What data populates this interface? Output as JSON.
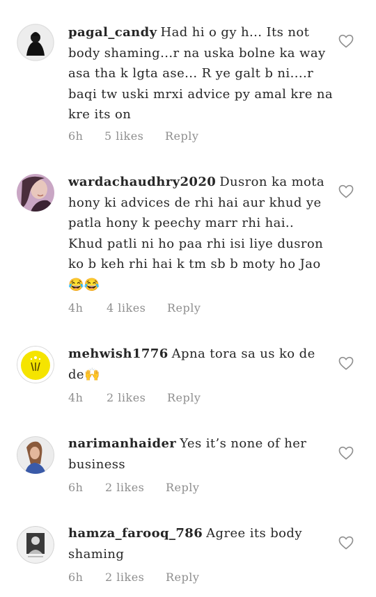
{
  "comments": [
    {
      "username": "pagal_candy",
      "text": "Had hi o gy h... Its not body shaming...r na uska bolne ka way asa tha k lgta ase... R ye galt b ni....r baqi tw uski mrxi advice py amal kre na kre its on",
      "time": "6h",
      "likes": "5 likes",
      "reply": "Reply"
    },
    {
      "username": "wardachaudhry2020",
      "text": "Dusron ka mota hony ki advices de rhi hai aur khud ye patla hony k peechy marr rhi hai.. Khud patli ni ho paa rhi isi liye dusron ko b keh rhi hai k tm sb b moty ho Jao😂😂",
      "time": "4h",
      "likes": "4 likes",
      "reply": "Reply"
    },
    {
      "username": "mehwish1776",
      "text": "Apna tora sa us ko de de🙌",
      "time": "4h",
      "likes": "2 likes",
      "reply": "Reply"
    },
    {
      "username": "narimanhaider",
      "text": "Yes it’s none of her business",
      "time": "6h",
      "likes": "2 likes",
      "reply": "Reply"
    },
    {
      "username": "hamza_farooq_786",
      "text": "Agree its body shaming",
      "time": "6h",
      "likes": "2 likes",
      "reply": "Reply"
    }
  ]
}
